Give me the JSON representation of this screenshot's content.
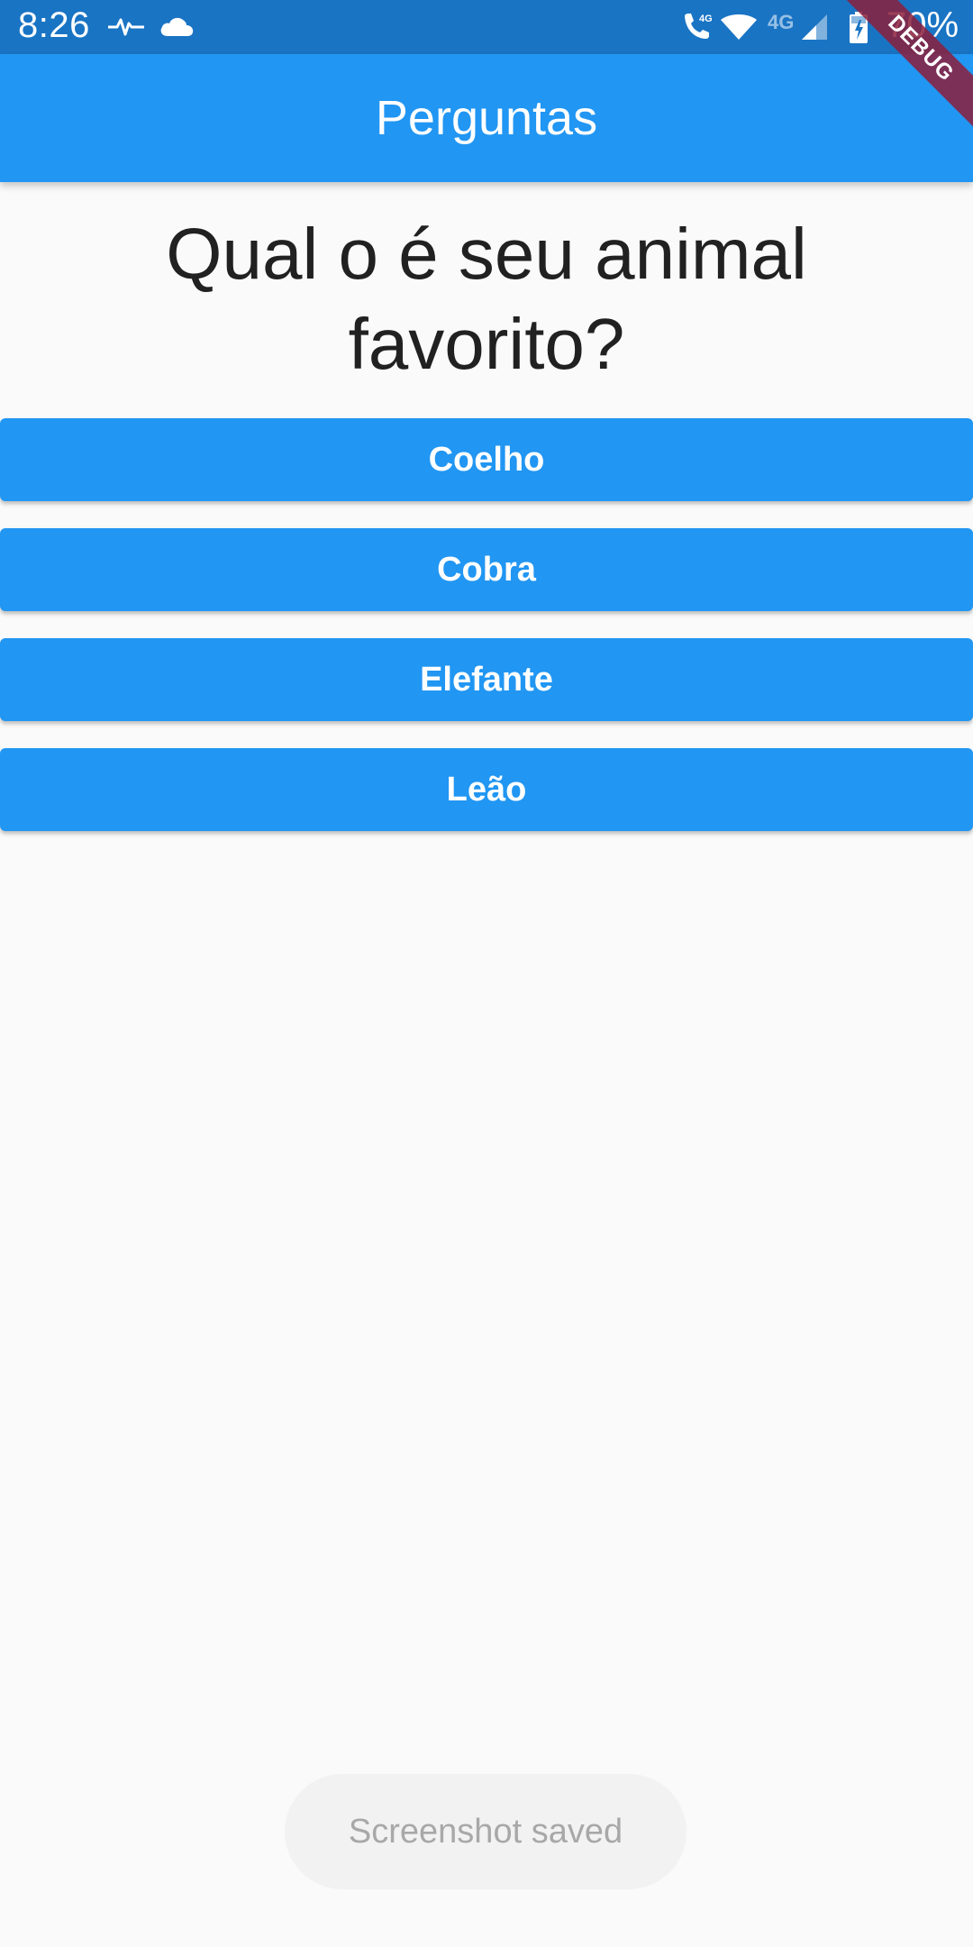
{
  "status_bar": {
    "time": "8:26",
    "network_type": "4G",
    "call_network": "4G",
    "battery_percent": "70%",
    "icons": [
      "pulse-icon",
      "cloud-icon",
      "call-icon",
      "wifi-icon",
      "signal-icon",
      "battery-charging-icon"
    ]
  },
  "debug_banner": "DEBUG",
  "app_bar": {
    "title": "Perguntas",
    "color": "#2196f3"
  },
  "question": "Qual o é seu animal favorito?",
  "answers": [
    {
      "label": "Coelho"
    },
    {
      "label": "Cobra"
    },
    {
      "label": "Elefante"
    },
    {
      "label": "Leão"
    }
  ],
  "toast": "Screenshot saved",
  "colors": {
    "primary": "#2196f3",
    "status_bar": "#1a74c4",
    "background": "#fafafa"
  }
}
